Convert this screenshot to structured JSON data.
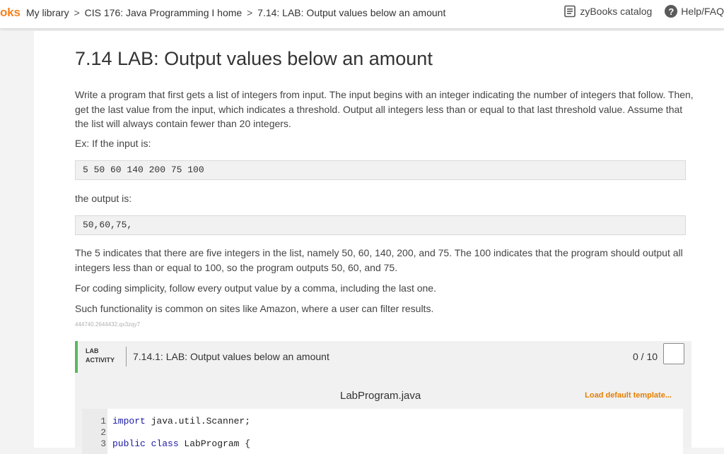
{
  "topbar": {
    "brand": "oks",
    "crumbs": [
      "My library",
      "CIS 176: Java Programming I home",
      "7.14: LAB: Output values below an amount"
    ],
    "separator": ">",
    "catalog_label": "zyBooks catalog",
    "help_label": "Help/FAQ",
    "help_glyph": "?",
    "brand_color": "#f58220"
  },
  "section": {
    "title": "7.14 LAB: Output values below an amount",
    "paragraph_1": "Write a program that first gets a list of integers from input. The input begins with an integer indicating the number of integers that follow. Then, get the last value from the input, which indicates a threshold. Output all integers less than or equal to that last threshold value. Assume that the list will always contain fewer than 20 integers.",
    "example_intro": "Ex: If the input is:",
    "example_input": "5 50 60 140 200 75 100",
    "output_intro": "the output is:",
    "example_output": "50,60,75,",
    "paragraph_2": "The 5 indicates that there are five integers in the list, namely 50, 60, 140, 200, and 75. The 100 indicates that the program should output all integers less than or equal to 100, so the program outputs 50, 60, and 75.",
    "paragraph_3": "For coding simplicity, follow every output value by a comma, including the last one.",
    "paragraph_4": "Such functionality is common on sites like Amazon, where a user can filter results.",
    "id_code": "444740.2644432.qx3zqy7"
  },
  "lab": {
    "tag_line1": "LAB",
    "tag_line2": "ACTIVITY",
    "title": "7.14.1: LAB: Output values below an amount",
    "score": "0 / 10",
    "accent_color": "#5cb85c"
  },
  "editor": {
    "file_name": "LabProgram.java",
    "load_default": "Load default template...",
    "lines": [
      {
        "num": "1",
        "keyword": "import",
        "rest": " java.util.Scanner;"
      },
      {
        "num": "2",
        "keyword": "",
        "rest": ""
      },
      {
        "num": "3",
        "keyword": "public class",
        "rest": " LabProgram {"
      }
    ]
  }
}
